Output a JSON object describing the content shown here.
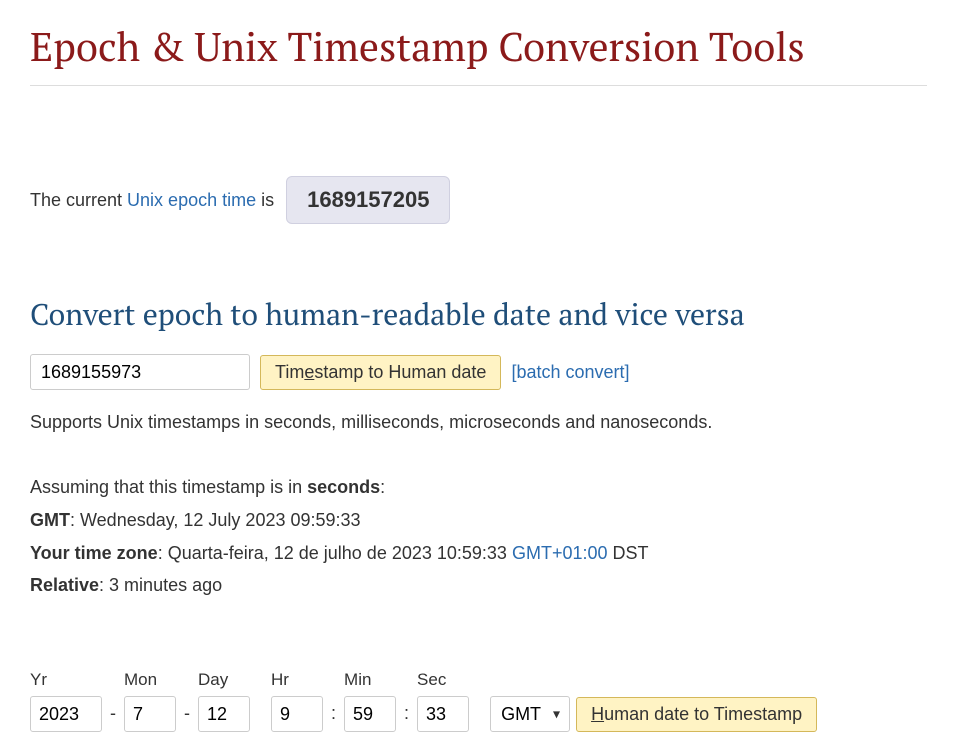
{
  "header": {
    "title": "Epoch & Unix Timestamp Conversion Tools"
  },
  "current": {
    "prefix": "The current ",
    "link_text": "Unix epoch time",
    "suffix": " is",
    "value": "1689157205"
  },
  "section": {
    "heading": "Convert epoch to human-readable date and vice versa",
    "timestamp_value": "1689155973",
    "button_ts_to_human": "Timestamp to Human date",
    "batch_convert": "[batch convert]",
    "supports_text": "Supports Unix timestamps in seconds, milliseconds, microseconds and nanoseconds."
  },
  "results": {
    "assuming_prefix": "Assuming that this timestamp is in ",
    "assuming_unit": "seconds",
    "assuming_suffix": ":",
    "gmt_label": "GMT",
    "gmt_value": ": Wednesday, 12 July 2023 09:59:33",
    "tz_label": "Your time zone",
    "tz_value": ": Quarta-feira, 12 de julho de 2023 10:59:33 ",
    "tz_offset": "GMT+01:00",
    "tz_dst": " DST",
    "relative_label": "Relative",
    "relative_value": ": 3 minutes ago"
  },
  "date_fields": {
    "yr_label": "Yr",
    "yr_value": "2023",
    "mon_label": "Mon",
    "mon_value": "7",
    "day_label": "Day",
    "day_value": "12",
    "hr_label": "Hr",
    "hr_value": "9",
    "min_label": "Min",
    "min_value": "59",
    "sec_label": "Sec",
    "sec_value": "33",
    "tz_selected": "GMT",
    "dash": "-",
    "colon": ":",
    "button_human_to_ts": "Human date to Timestamp"
  }
}
